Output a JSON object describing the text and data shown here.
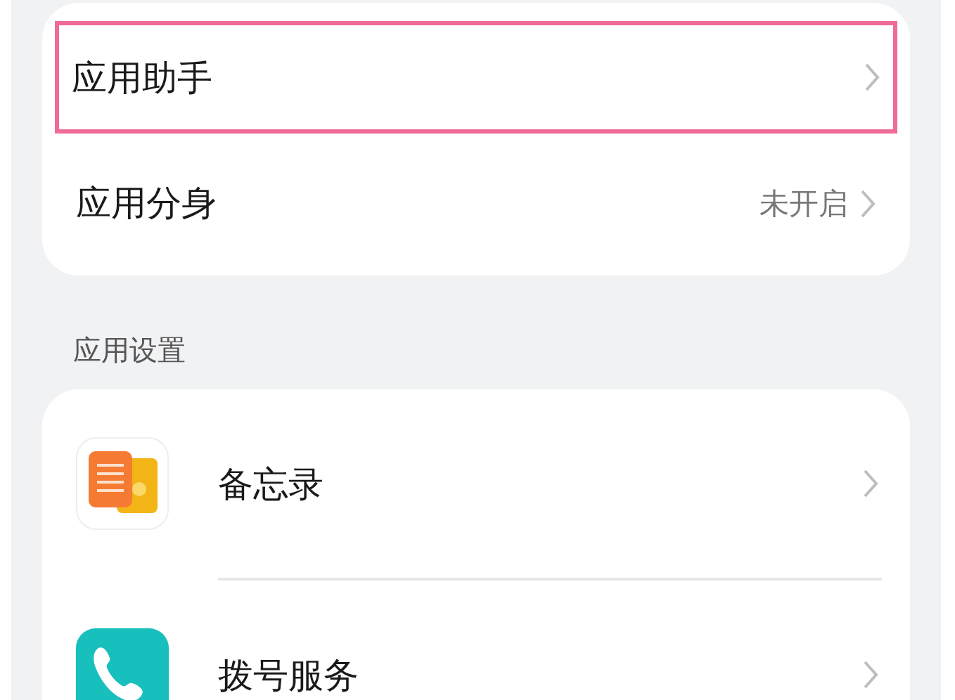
{
  "top_group": {
    "items": [
      {
        "label": "应用助手",
        "value": null,
        "highlighted": true
      },
      {
        "label": "应用分身",
        "value": "未开启",
        "highlighted": false
      }
    ]
  },
  "section": {
    "title": "应用设置",
    "items": [
      {
        "label": "备忘录",
        "kind": "notes"
      },
      {
        "label": "拨号服务",
        "kind": "phone"
      }
    ]
  }
}
